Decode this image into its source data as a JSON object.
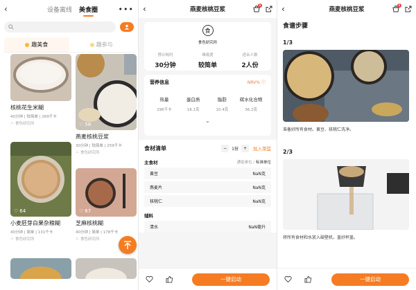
{
  "colors": {
    "accent": "#f57c22",
    "badge": "#e53935"
  },
  "feed": {
    "back_icon": "chevron-left-icon",
    "tabs": [
      "设备离线",
      "美食圈"
    ],
    "active_tab": "美食圈",
    "more_icon": "ellipsis-icon",
    "subtabs": [
      "趣美食",
      "趣参与"
    ],
    "cards": [
      {
        "title": "核桃花生米糊",
        "meta": "40分钟 | 较简单 | 269千卡",
        "author": "食色研究所",
        "likes": ""
      },
      {
        "title": "燕麦核桃豆浆",
        "meta": "30分钟 | 较简单 | 259千卡",
        "author": "食色研究所",
        "likes": "58"
      },
      {
        "title": "小麦胚芽白果杂粮糊",
        "meta": "40分钟 | 简单 | 131千卡",
        "author": "食色研究所",
        "likes": "64"
      },
      {
        "title": "芝麻核桃糊",
        "meta": "40分钟 | 简单 | 178千卡",
        "author": "食色研究所",
        "likes": "67"
      }
    ]
  },
  "detail": {
    "title": "燕麦核桃豆浆",
    "cart_badge": "1",
    "brand_logo": "食",
    "brand_name": "食色研究所",
    "stats": [
      {
        "label": "预计耗时",
        "value": "30分钟"
      },
      {
        "label": "难易度",
        "value": "较简单"
      },
      {
        "label": "适合人数",
        "value": "2人份"
      }
    ],
    "nutrition_title": "营养信息",
    "nrv_label": "NRV%",
    "nutrition": [
      {
        "name": "热量",
        "value": "296千卡"
      },
      {
        "name": "蛋白质",
        "value": "18.1克"
      },
      {
        "name": "脂肪",
        "value": "10.4克"
      },
      {
        "name": "碳水化合物",
        "value": "36.2克"
      }
    ],
    "ingredients_title": "食材清单",
    "servings": "1份",
    "add_to_list": "加入菜篮",
    "main_group": "主食材",
    "unit_normal": "通俗单位",
    "unit_standard": "标准单位",
    "main_items": [
      {
        "name": "黄豆",
        "qty": "NaN克"
      },
      {
        "name": "燕麦片",
        "qty": "NaN克"
      },
      {
        "name": "核桃仁",
        "qty": "NaN克"
      }
    ],
    "aux_group": "辅料",
    "aux_items": [
      {
        "name": "清水",
        "qty": "NaN毫升"
      }
    ],
    "start_button": "一键启动"
  },
  "steps": {
    "title": "燕麦核桃豆浆",
    "section_title": "食谱步骤",
    "items": [
      {
        "num": "1/3",
        "text": "准备好所有食材。黄豆、核桃仁洗净。"
      },
      {
        "num": "2/3",
        "text": "将所有食材和水放入破壁机，盖好杯盖。"
      }
    ],
    "start_button": "一键启动"
  }
}
